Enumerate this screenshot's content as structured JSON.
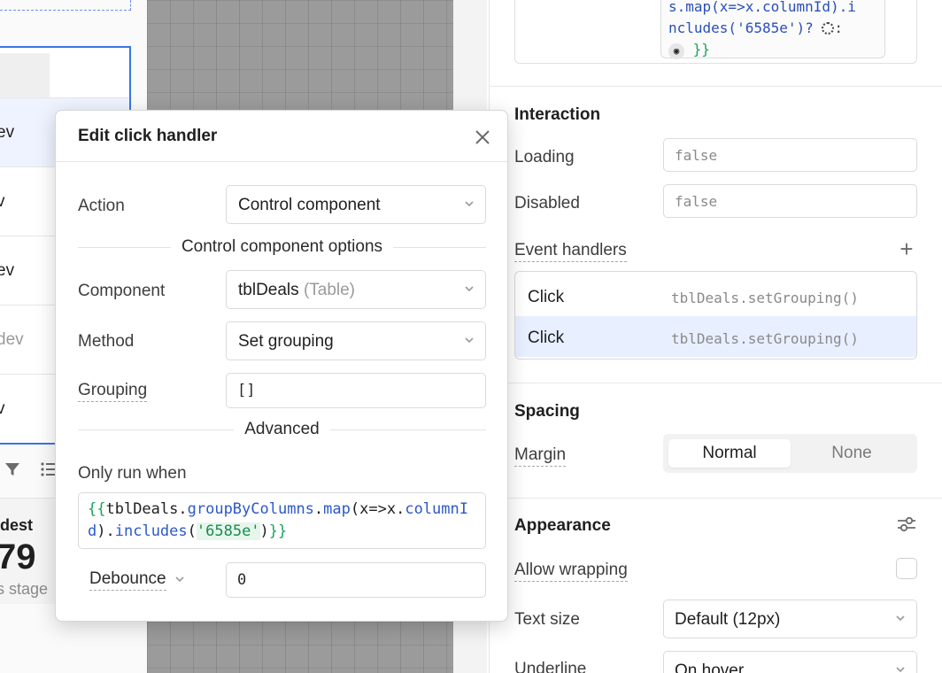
{
  "background": {
    "table_rows": [
      "ev",
      "v",
      "ev",
      "dev",
      "v"
    ],
    "stat": {
      "label": "dest",
      "value": "79",
      "caption": "s stage"
    }
  },
  "inspector": {
    "code_snippet": {
      "line1": "s.map(x=>x.columnId).i",
      "line2": "ncludes('6585e')?",
      "line3": "}}"
    },
    "interaction": {
      "title": "Interaction",
      "loading_label": "Loading",
      "loading_value": "false",
      "disabled_label": "Disabled",
      "disabled_value": "false",
      "event_handlers_label": "Event handlers",
      "handlers": [
        {
          "event": "Click",
          "action": "tblDeals.setGrouping()"
        },
        {
          "event": "Click",
          "action": "tblDeals.setGrouping()"
        }
      ]
    },
    "spacing": {
      "title": "Spacing",
      "margin_label": "Margin",
      "margin_options": [
        "Normal",
        "None"
      ],
      "margin_selected": "Normal"
    },
    "appearance": {
      "title": "Appearance",
      "allow_wrapping_label": "Allow wrapping",
      "text_size_label": "Text size",
      "text_size_value": "Default (12px)",
      "underline_label": "Underline",
      "underline_value": "On hover"
    }
  },
  "modal": {
    "title": "Edit click handler",
    "action_label": "Action",
    "action_value": "Control component",
    "options_divider": "Control component options",
    "component_label": "Component",
    "component_value": "tblDeals",
    "component_type": "(Table)",
    "method_label": "Method",
    "method_value": "Set grouping",
    "grouping_label": "Grouping",
    "grouping_value": "[]",
    "advanced_divider": "Advanced",
    "only_run_when_label": "Only run when",
    "only_run_when": {
      "open": "{{",
      "var": "tblDeals",
      "dot1": ".",
      "prop1": "groupByColumns",
      "dot2": ".",
      "prop2": "map",
      "arg_open": "(x=>x",
      "dot3": ".",
      "prop3": "columnId",
      "arg_close": ")",
      "dot4": ".",
      "prop4": "includes",
      "paren_open": "(",
      "str": "'6585e'",
      "paren_close": ")",
      "close": "}}"
    },
    "debounce_label": "Debounce",
    "debounce_value": "0"
  },
  "colors": {
    "accent": "#3b73e6",
    "selected_row": "#e8efff",
    "code_brace": "#19a35a",
    "code_prop": "#2c58c9"
  }
}
